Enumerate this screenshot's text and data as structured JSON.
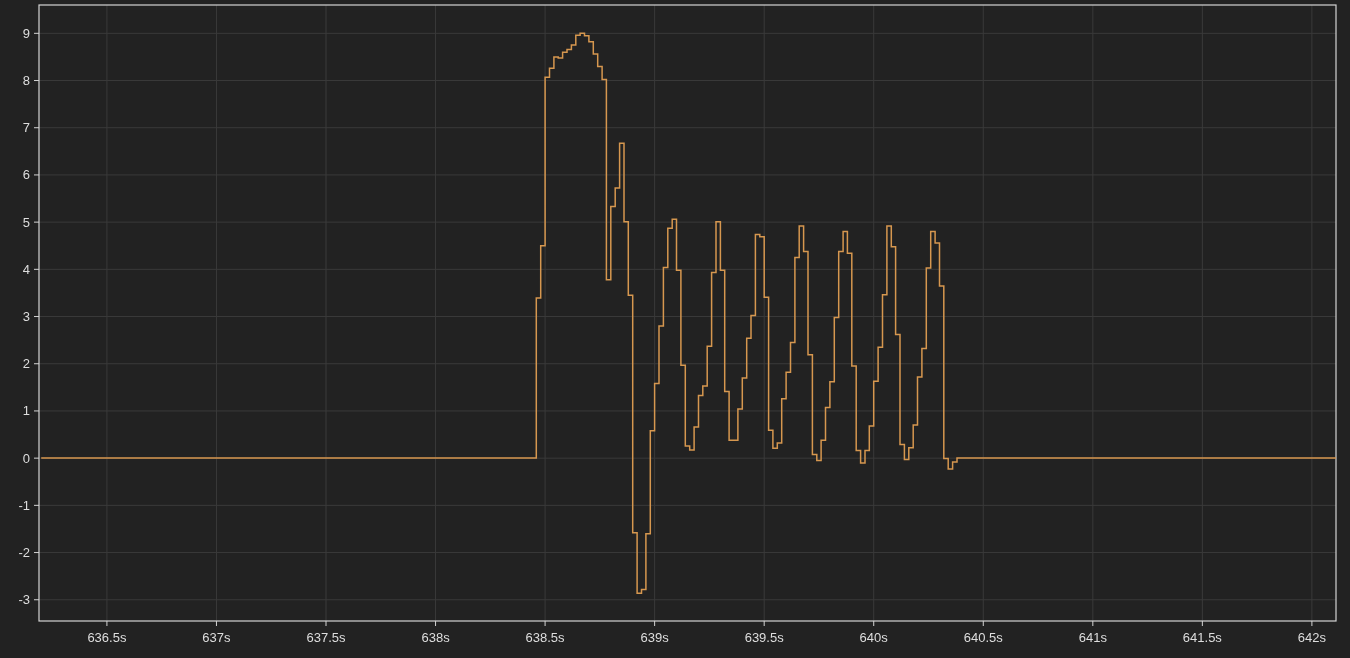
{
  "chart": {
    "chart_data": {
      "type": "line",
      "x": [
        636.2,
        638.44,
        638.46,
        638.48,
        638.5,
        638.52,
        638.54,
        638.56,
        638.58,
        638.6,
        638.62,
        638.64,
        638.66,
        638.68,
        638.7,
        638.72,
        638.74,
        638.76,
        638.78,
        638.8,
        638.82,
        638.84,
        638.86,
        638.88,
        638.9,
        638.92,
        638.94,
        638.96,
        638.98,
        639.0,
        639.02,
        639.04,
        639.06,
        639.08,
        639.1,
        639.12,
        639.14,
        639.16,
        639.18,
        639.2,
        639.22,
        639.24,
        639.26,
        639.28,
        639.3,
        639.32,
        639.34,
        639.36,
        639.38,
        639.4,
        639.42,
        639.44,
        639.46,
        639.48,
        639.5,
        639.52,
        639.54,
        639.56,
        639.58,
        639.6,
        639.62,
        639.64,
        639.66,
        639.68,
        639.7,
        639.72,
        639.74,
        639.76,
        639.78,
        639.8,
        639.82,
        639.84,
        639.86,
        639.88,
        639.9,
        639.92,
        639.94,
        639.96,
        639.98,
        640.0,
        640.02,
        640.04,
        640.06,
        640.08,
        640.1,
        640.12,
        640.14,
        640.16,
        640.18,
        640.2,
        640.22,
        640.24,
        640.26,
        640.28,
        640.3,
        640.32,
        640.34,
        640.36,
        640.38,
        640.4,
        642.11
      ],
      "series": [
        {
          "color": "#d6974f",
          "values": [
            0,
            0,
            3.39,
            4.5,
            8.07,
            8.26,
            8.5,
            8.48,
            8.6,
            8.66,
            8.75,
            8.96,
            9.0,
            8.95,
            8.82,
            8.56,
            8.3,
            8.02,
            3.78,
            5.33,
            5.72,
            6.67,
            5.01,
            3.45,
            -1.58,
            -2.86,
            -2.78,
            -1.6,
            0.58,
            1.58,
            2.8,
            4.04,
            4.87,
            5.06,
            3.98,
            1.97,
            0.26,
            0.17,
            0.66,
            1.33,
            1.53,
            2.37,
            3.93,
            5.01,
            3.98,
            1.41,
            0.38,
            0.38,
            1.04,
            1.7,
            2.54,
            3.02,
            4.74,
            4.69,
            3.41,
            0.59,
            0.21,
            0.32,
            1.26,
            1.82,
            2.45,
            4.25,
            4.92,
            4.38,
            2.19,
            0.08,
            -0.05,
            0.38,
            1.07,
            1.62,
            2.98,
            4.38,
            4.8,
            4.34,
            1.95,
            0.16,
            -0.1,
            0.16,
            0.68,
            1.63,
            2.35,
            3.46,
            4.92,
            4.48,
            2.62,
            0.29,
            -0.03,
            0.22,
            0.7,
            1.72,
            2.32,
            4.03,
            4.8,
            4.56,
            3.65,
            -0.01,
            -0.23,
            -0.08,
            0,
            0,
            0
          ]
        }
      ],
      "xlim": [
        636.19,
        642.11
      ],
      "ylim": [
        -3.45,
        9.6
      ],
      "xticks": [
        {
          "value": 636.5,
          "label": "636.5s"
        },
        {
          "value": 637,
          "label": "637s"
        },
        {
          "value": 637.5,
          "label": "637.5s"
        },
        {
          "value": 638,
          "label": "638s"
        },
        {
          "value": 638.5,
          "label": "638.5s"
        },
        {
          "value": 639,
          "label": "639s"
        },
        {
          "value": 639.5,
          "label": "639.5s"
        },
        {
          "value": 640,
          "label": "640s"
        },
        {
          "value": 640.5,
          "label": "640.5s"
        },
        {
          "value": 641,
          "label": "641s"
        },
        {
          "value": 641.5,
          "label": "641.5s"
        },
        {
          "value": 642,
          "label": "642s"
        }
      ],
      "yticks": [
        -3,
        -2,
        -1,
        0,
        1,
        2,
        3,
        4,
        5,
        6,
        7,
        8,
        9
      ],
      "grid": true
    }
  }
}
